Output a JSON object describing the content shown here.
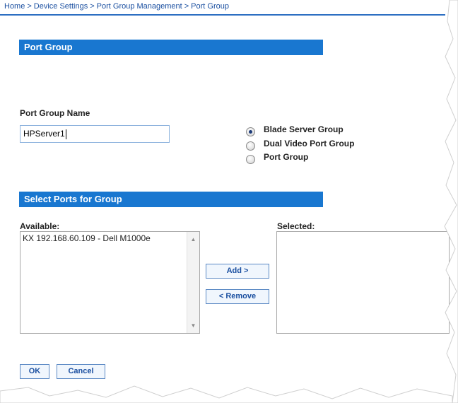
{
  "breadcrumb": [
    "Home",
    "Device Settings",
    "Port Group Management",
    "Port Group"
  ],
  "breadcrumb_separator": ">",
  "section_port_group": {
    "title": "Port Group"
  },
  "port_group_name": {
    "label": "Port Group Name",
    "value": "HPServer1"
  },
  "group_type": {
    "options": [
      "Blade Server Group",
      "Dual Video Port Group",
      "Port Group"
    ],
    "selected": "Blade Server Group"
  },
  "section_select_ports": {
    "title": "Select Ports for Group"
  },
  "available": {
    "label": "Available:",
    "items": [
      "KX 192.168.60.109 - Dell M1000e"
    ]
  },
  "selected": {
    "label": "Selected:",
    "items": []
  },
  "buttons": {
    "add": "Add >",
    "remove": "< Remove",
    "ok": "OK",
    "cancel": "Cancel"
  },
  "colors": {
    "section_bar": "#1977d0",
    "link": "#1a4fa0",
    "button_border": "#5b89c4"
  }
}
